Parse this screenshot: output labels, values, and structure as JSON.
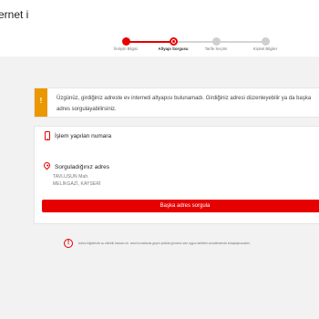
{
  "header": {
    "title": "ernet i"
  },
  "stepper": {
    "steps": [
      {
        "label": "İletişim Bilgisi",
        "state": "done"
      },
      {
        "label": "Altyapı Sorgusu",
        "state": "current"
      },
      {
        "label": "Tarife Seçimi",
        "state": "upcoming"
      },
      {
        "label": "Kişisel Bilgiler",
        "state": "upcoming"
      }
    ]
  },
  "alert": {
    "icon": "exclamation-icon",
    "text": "Üzgünüz, girdiğiniz adreste ev interneti altyapısı bulunamadı. Girdiğiniz adresi düzenleyebilir ya da başka adres sorgulayabilirsiniz."
  },
  "card": {
    "phone": {
      "icon": "phone-icon",
      "title": "İşlem yapılan numara"
    },
    "address": {
      "icon": "location-pin-icon",
      "title": "Sorguladığınız adres",
      "line1": "TAVLUSUN Mah.",
      "line2": "MELİKGAZİ, KAYSERİ"
    },
    "button_label": "Başka adres sorgula"
  },
  "info": {
    "icon": "info-icon",
    "text": "Adres bilgilerinizi su elektrik faturası vb. resmi evraklarda geçen şekilde girmeniz size uygun tarifeleri sunabilmemizi kolaylaştıracaktır."
  },
  "colors": {
    "brand_red": "#e60000",
    "warning": "#eb9700",
    "background": "#f2f2f2"
  }
}
